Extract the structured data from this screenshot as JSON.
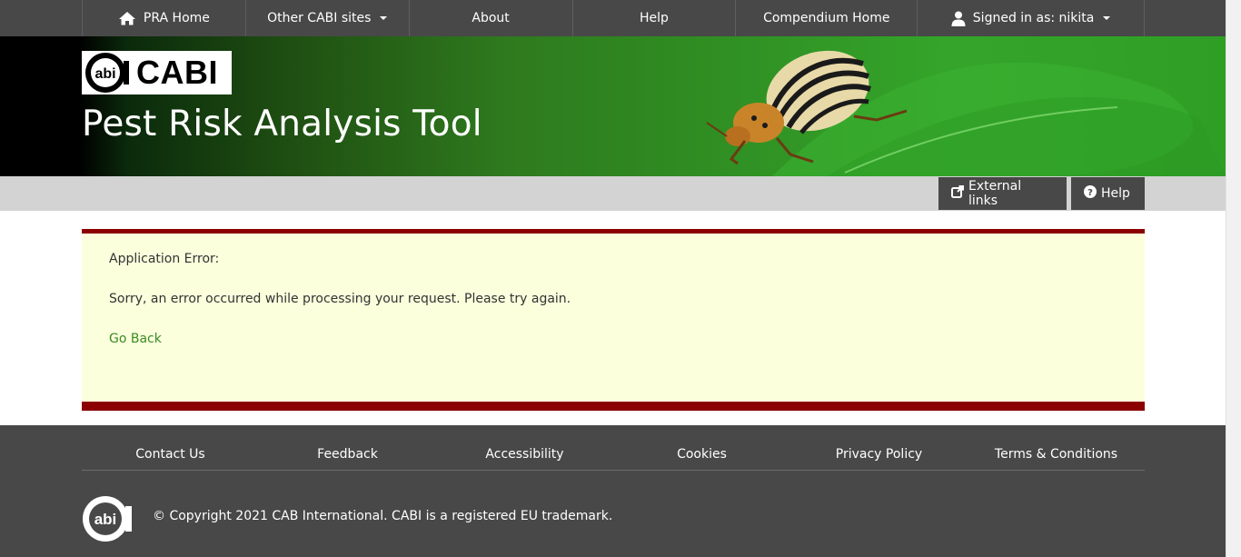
{
  "nav": {
    "home": "PRA Home",
    "other_sites": "Other CABI sites",
    "about": "About",
    "help": "Help",
    "compendium": "Compendium Home",
    "signed_in": "Signed in as: nikita"
  },
  "banner": {
    "logo_text": "CABI",
    "title": "Pest Risk Analysis Tool"
  },
  "toolbar": {
    "external_links": "External links",
    "help": "Help"
  },
  "error": {
    "heading": "Application Error:",
    "message": "Sorry, an error occurred while processing your request. Please try again.",
    "go_back": "Go Back"
  },
  "footer": {
    "links": [
      "Contact Us",
      "Feedback",
      "Accessibility",
      "Cookies",
      "Privacy Policy",
      "Terms & Conditions"
    ],
    "copyright": "© Copyright 2021 CAB International. CABI is a registered EU trademark."
  },
  "colors": {
    "nav_bg": "#484848",
    "error_border": "#8b0000",
    "error_bg": "#fbffdc",
    "link": "#3b8a23"
  }
}
